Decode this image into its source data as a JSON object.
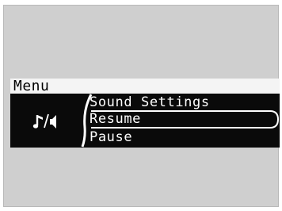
{
  "menu": {
    "title": "Menu",
    "items": [
      {
        "label": "Sound Settings",
        "selected": false
      },
      {
        "label": "Resume",
        "selected": true
      },
      {
        "label": "Pause",
        "selected": false
      }
    ]
  },
  "icons": {
    "source": "music-speaker-icon"
  },
  "colors": {
    "panel": "#0a0a0a",
    "title_bar": "#f4f4f4",
    "screen": "#cfcfcf",
    "text_light": "#ffffff",
    "text_dark": "#000000"
  }
}
